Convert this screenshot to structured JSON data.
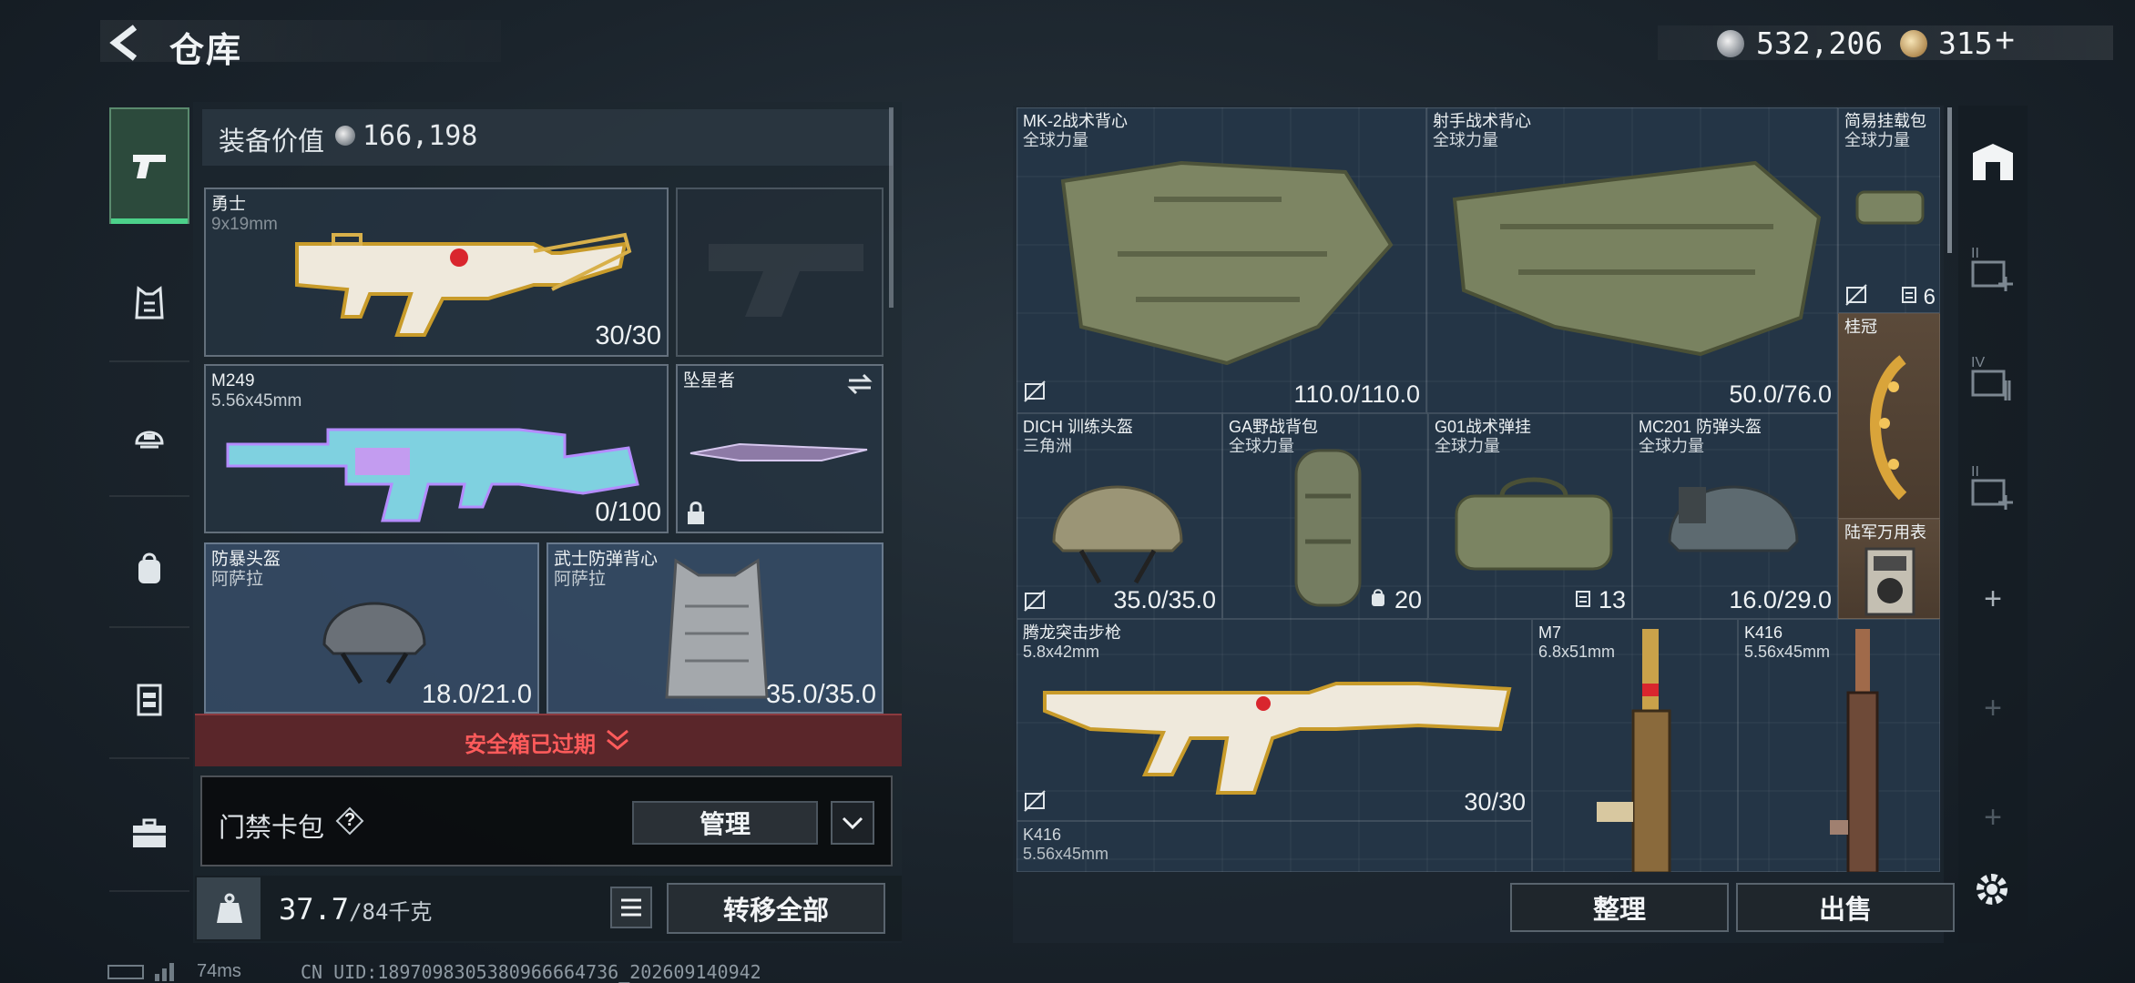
{
  "header": {
    "title": "仓库",
    "silver_value": "532,206",
    "gold_value": "315",
    "gold_add": "+"
  },
  "left_panel": {
    "equipment_value_label": "装备价值",
    "equipment_value": "166,198",
    "slots": {
      "primary": {
        "name": "勇士",
        "ammo": "9x19mm",
        "count": "30/30"
      },
      "sidearm": {
        "name": ""
      },
      "secondary": {
        "name": "M249",
        "ammo": "5.56x45mm",
        "count": "0/100"
      },
      "melee": {
        "name": "坠星者"
      },
      "helmet": {
        "name": "防暴头盔",
        "origin": "阿萨拉",
        "count": "18.0/21.0"
      },
      "armor": {
        "name": "武士防弹背心",
        "origin": "阿萨拉",
        "count": "35.0/35.0"
      }
    },
    "safe_box_status": "安全箱已过期",
    "keycard_label": "门禁卡包",
    "help_symbol": "?",
    "manage_label": "管理",
    "weight_value": "37.7",
    "weight_max": "/84千克",
    "transfer_all_label": "转移全部"
  },
  "storage_items": [
    {
      "name": "MK-2战术背心",
      "sub": "全球力量",
      "count": "110.0/110.0"
    },
    {
      "name": "射手战术背心",
      "sub": "全球力量",
      "count": "50.0/76.0"
    },
    {
      "name": "简易挂载包",
      "sub": "全球力量",
      "count": "6"
    },
    {
      "name": "桂冠",
      "sub": "",
      "count": ""
    },
    {
      "name": "DICH 训练头盔",
      "sub": "三角洲",
      "count": "35.0/35.0"
    },
    {
      "name": "GA野战背包",
      "sub": "全球力量",
      "count": "20"
    },
    {
      "name": "G01战术弹挂",
      "sub": "全球力量",
      "count": "13"
    },
    {
      "name": "MC201 防弹头盔",
      "sub": "全球力量",
      "count": "16.0/29.0"
    },
    {
      "name": "陆军万用表",
      "sub": "",
      "count": ""
    },
    {
      "name": "腾龙突击步枪",
      "sub": "5.8x42mm",
      "count": "30/30"
    },
    {
      "name": "M7",
      "sub": "6.8x51mm",
      "count": ""
    },
    {
      "name": "K416",
      "sub": "5.56x45mm",
      "count": ""
    },
    {
      "name": "K416",
      "sub": "5.56x45mm",
      "count": ""
    }
  ],
  "right_rail": {
    "tier_labels": [
      "II",
      "IV",
      "II"
    ],
    "plus": "+"
  },
  "actions": {
    "sort_label": "整理",
    "sell_label": "出售"
  },
  "footer": {
    "ping": "74ms",
    "uid": "CN UID:1897098305380966664736_202609140942"
  },
  "colors": {
    "accent_green": "#4cd18a",
    "expired_red": "#ff5b5b",
    "gold": "#d4aa3a"
  }
}
